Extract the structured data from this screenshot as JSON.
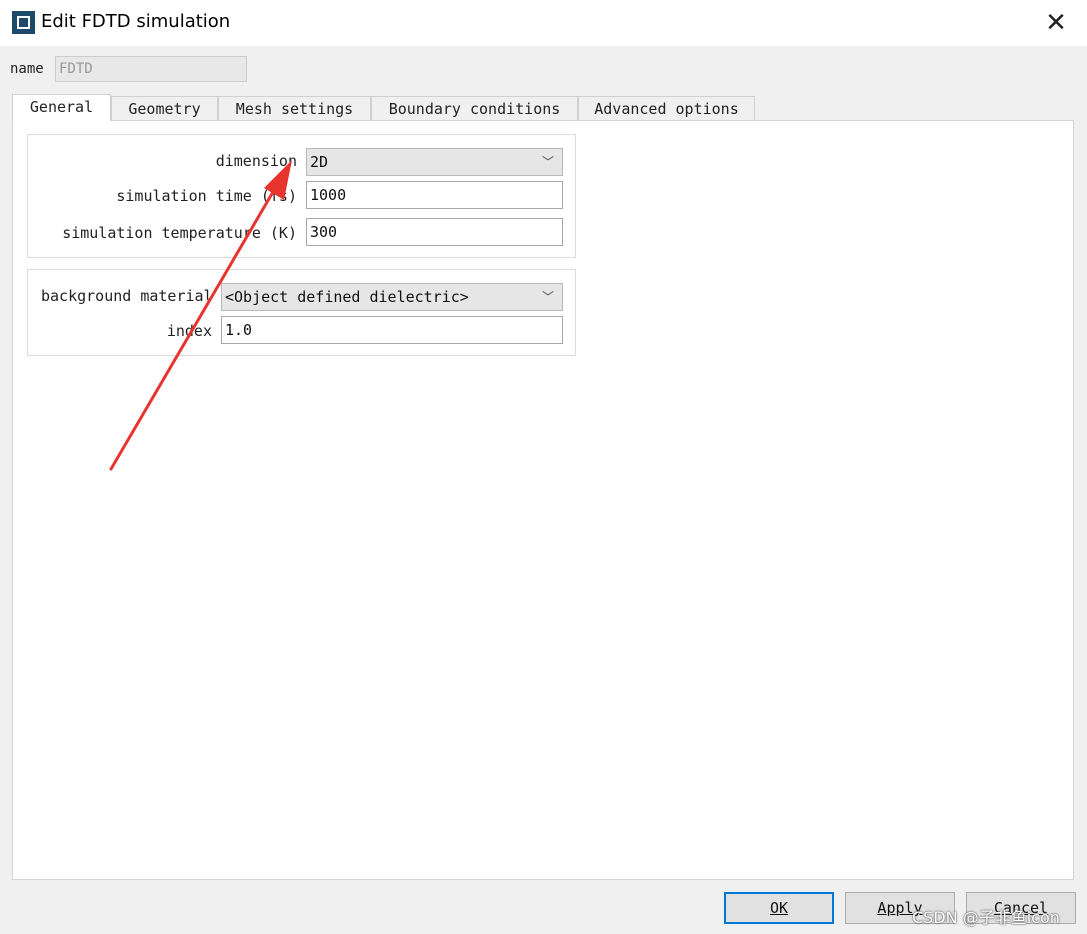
{
  "window": {
    "title": "Edit FDTD simulation"
  },
  "name_field": {
    "label": "name",
    "value": "FDTD"
  },
  "tabs": [
    {
      "label": "General",
      "active": true
    },
    {
      "label": "Geometry"
    },
    {
      "label": "Mesh settings"
    },
    {
      "label": "Boundary conditions"
    },
    {
      "label": "Advanced options"
    }
  ],
  "general": {
    "dimension_label": "dimension",
    "dimension_value": "2D",
    "sim_time_label": "simulation time (fs)",
    "sim_time_value": "1000",
    "sim_temp_label": "simulation temperature (K)",
    "sim_temp_value": "300",
    "bg_material_label": "background material",
    "bg_material_value": "<Object defined dielectric>",
    "index_label": "index",
    "index_value": "1.0"
  },
  "buttons": {
    "ok": "OK",
    "apply": "Apply",
    "cancel": "Cancel"
  },
  "watermark": "CSDN @子非鱼icon",
  "colors": {
    "annotation_arrow": "#e8342e",
    "focus_border": "#0078d7",
    "app_icon": "#1b4a6b"
  }
}
